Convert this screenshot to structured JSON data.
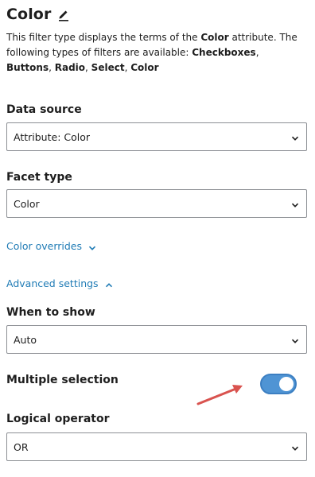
{
  "header": {
    "title": "Color",
    "edit_icon": "pencil-icon"
  },
  "description": {
    "pre": "This filter type displays the terms of the ",
    "attribute": "Color",
    "mid": " attribute. The following types of filters are available: ",
    "type1": "Checkboxes",
    "sep1": ", ",
    "type2": "Buttons",
    "sep2": ", ",
    "type3": "Radio",
    "sep3": ", ",
    "type4": "Select",
    "sep4": ", ",
    "type5": "Color"
  },
  "data_source": {
    "label": "Data source",
    "value": "Attribute: Color"
  },
  "facet_type": {
    "label": "Facet type",
    "value": "Color"
  },
  "color_overrides": {
    "label": "Color overrides",
    "state": "collapsed"
  },
  "advanced_settings": {
    "label": "Advanced settings",
    "state": "expanded"
  },
  "when_to_show": {
    "label": "When to show",
    "value": "Auto"
  },
  "multiple_selection": {
    "label": "Multiple selection",
    "enabled": true
  },
  "logical_operator": {
    "label": "Logical operator",
    "value": "OR"
  },
  "colors": {
    "accent": "#4f94d4",
    "link": "#1f7bb5",
    "annotation_arrow": "#d9534f"
  }
}
